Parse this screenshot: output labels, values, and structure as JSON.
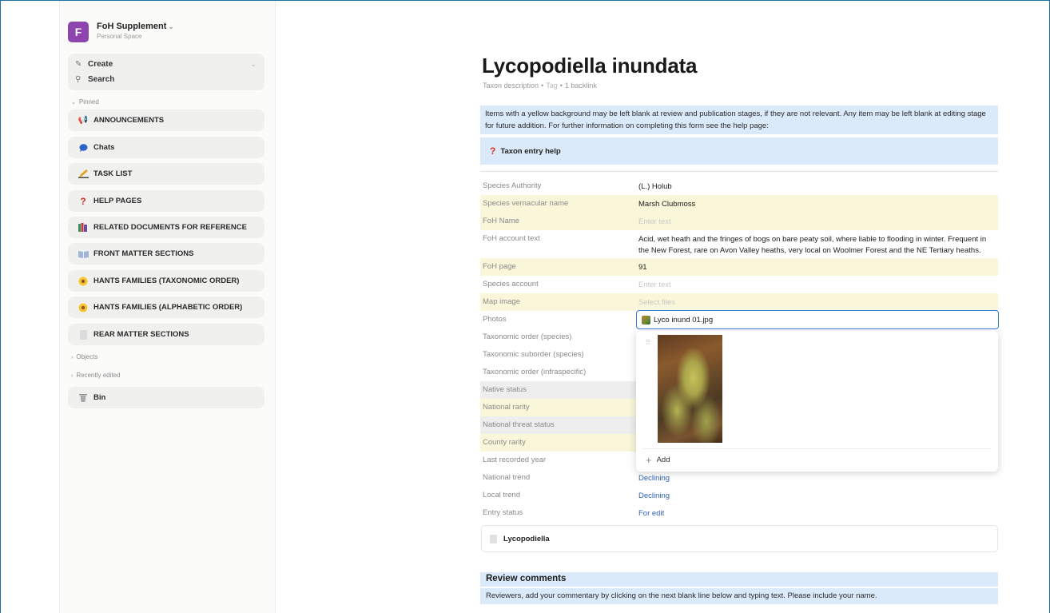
{
  "sidebar": {
    "space": {
      "initial": "F",
      "title": "FoH Supplement",
      "subtitle": "Personal Space"
    },
    "create_label": "Create",
    "search_label": "Search",
    "pinned_label": "Pinned",
    "items": [
      {
        "label": "ANNOUNCEMENTS",
        "icon": "megaphone-icon"
      },
      {
        "label": "Chats",
        "icon": "chat-bubble-icon"
      },
      {
        "label": "TASK LIST",
        "icon": "pencil-icon"
      },
      {
        "label": "HELP PAGES",
        "icon": "question-mark-icon"
      },
      {
        "label": "RELATED DOCUMENTS FOR REFERENCE",
        "icon": "books-icon"
      },
      {
        "label": "FRONT MATTER SECTIONS",
        "icon": "book-open-icon"
      },
      {
        "label": "HANTS FAMILIES (TAXONOMIC ORDER)",
        "icon": "sunflower-icon"
      },
      {
        "label": "HANTS FAMILIES (ALPHABETIC ORDER)",
        "icon": "sunflower-icon"
      },
      {
        "label": "REAR MATTER SECTIONS",
        "icon": "document-icon"
      }
    ],
    "objects_label": "Objects",
    "recent_label": "Recently edited",
    "bin_label": "Bin"
  },
  "page": {
    "title": "Lycopodiella inundata",
    "meta_type": "Taxon description",
    "meta_tag": "Tag",
    "meta_backlinks": "1 backlink",
    "callout": "Items with a yellow background may be left blank at review and publication stages, if they are not relevant. Any item may be left blank at editing stage for future addition. For further information on completing this form see the help page:",
    "help_link": "Taxon entry help"
  },
  "fields": [
    {
      "label": "Species Authority",
      "value": "(L.) Holub",
      "style": "plain",
      "kind": "text"
    },
    {
      "label": "Species vernacular name",
      "value": "Marsh Clubmoss",
      "style": "yellow",
      "kind": "text"
    },
    {
      "label": "FoH Name",
      "value": "Enter text",
      "style": "yellow",
      "kind": "placeholder"
    },
    {
      "label": "FoH account text",
      "value": "Acid, wet heath and the fringes of bogs on bare peaty soil, where liable to flooding in winter. Frequent in the New Forest, rare on Avon Valley heaths, very local on Woolmer Forest and the NE Tertiary heaths.",
      "style": "plain",
      "kind": "text",
      "tall": true
    },
    {
      "label": "FoH page",
      "value": "91",
      "style": "yellow",
      "kind": "text"
    },
    {
      "label": "Species account",
      "value": "Enter text",
      "style": "plain",
      "kind": "placeholder"
    },
    {
      "label": "Map image",
      "value": "Select files",
      "style": "yellow",
      "kind": "placeholder"
    },
    {
      "label": "Photos",
      "value": "",
      "style": "plain",
      "kind": "text"
    },
    {
      "label": "Taxonomic order (species)",
      "value": "",
      "style": "plain",
      "kind": "text"
    },
    {
      "label": "Taxonomic suborder (species)",
      "value": "",
      "style": "plain",
      "kind": "text"
    },
    {
      "label": "Taxonomic order (infraspecific)",
      "value": "",
      "style": "plain",
      "kind": "text"
    },
    {
      "label": "Native status",
      "value": "",
      "style": "grey",
      "kind": "text"
    },
    {
      "label": "National rarity",
      "value": "",
      "style": "yellow",
      "kind": "text"
    },
    {
      "label": "National threat status",
      "value": "",
      "style": "grey",
      "kind": "text"
    },
    {
      "label": "County rarity",
      "value": "",
      "style": "yellow",
      "kind": "text"
    },
    {
      "label": "Last recorded year",
      "value": "",
      "style": "plain",
      "kind": "text"
    },
    {
      "label": "National trend",
      "value": "Declining",
      "style": "plain",
      "kind": "link"
    },
    {
      "label": "Local trend",
      "value": "Declining",
      "style": "plain",
      "kind": "link"
    },
    {
      "label": "Entry status",
      "value": "For edit",
      "style": "plain",
      "kind": "link"
    }
  ],
  "photos": {
    "file_name": "Lyco inund 01.jpg",
    "add_label": "Add"
  },
  "parent_link": "Lycopodiella",
  "review": {
    "heading": "Review comments",
    "instructions": "Reviewers, add your commentary by clicking on the next blank line below and typing text. Please include your name."
  },
  "colors": {
    "accent": "#3d7bd9",
    "callout_bg": "#dbeafa",
    "yellow_row": "#faf6da",
    "grey_row": "#eeeeee",
    "avatar": "#8e44ad",
    "link": "#2f63b8"
  }
}
